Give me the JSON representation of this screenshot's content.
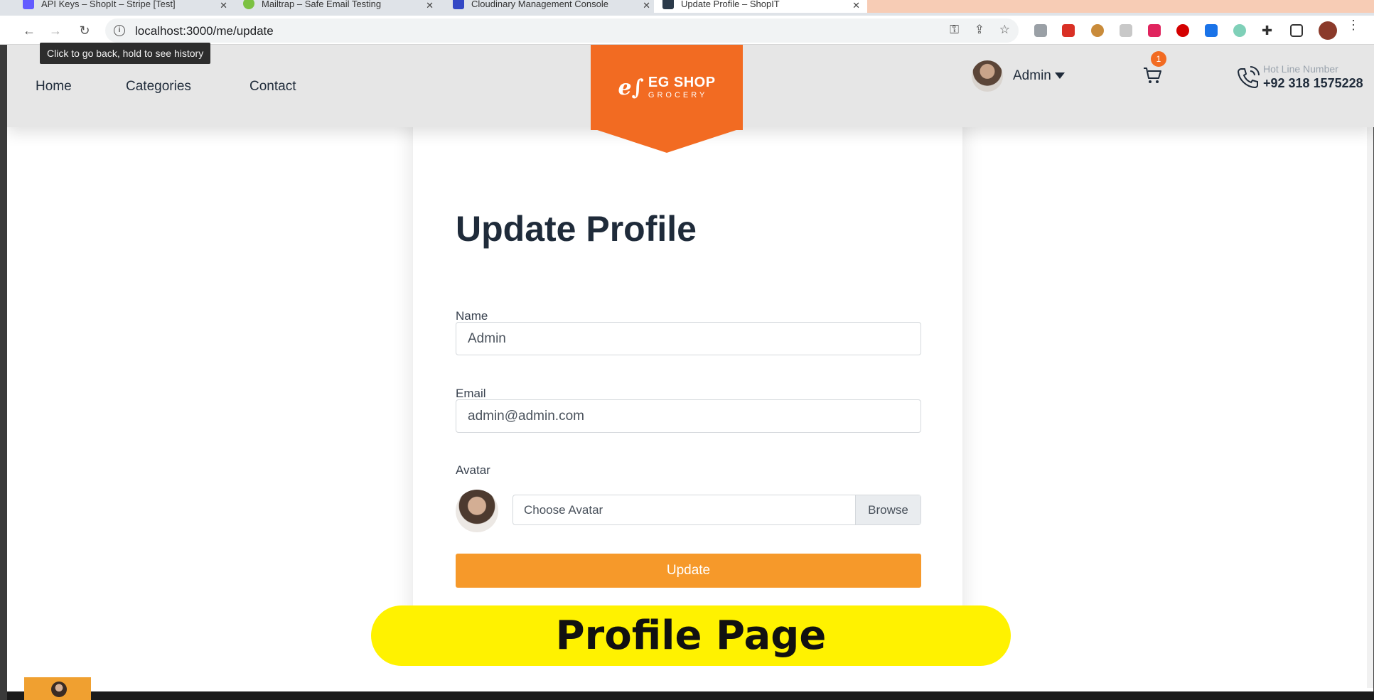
{
  "browser": {
    "tabs": [
      {
        "title": "API Keys – ShopIt – Stripe [Test]",
        "color": "#635bff"
      },
      {
        "title": "Mailtrap – Safe Email Testing",
        "color": "#7cc142"
      },
      {
        "title": "Cloudinary Management Console",
        "color": "#3448c5"
      },
      {
        "title": "Update Profile – ShopIT",
        "color": "#2b3a4a"
      }
    ],
    "url": "localhost:3000/me/update",
    "back_tooltip": "Click to go back, hold to see history"
  },
  "header": {
    "nav": [
      "Home",
      "Categories",
      "Contact"
    ],
    "logo_line1": "EG SHOP",
    "logo_line2": "GROCERY",
    "logo_mark": "e∫",
    "user_name": "Admin",
    "cart_count": "1",
    "hotline_label": "Hot Line Number",
    "hotline_number": "+92 318 1575228"
  },
  "form": {
    "title": "Update Profile",
    "name_label": "Name",
    "name_value": "Admin",
    "email_label": "Email",
    "email_value": "admin@admin.com",
    "avatar_label": "Avatar",
    "file_placeholder": "Choose Avatar",
    "browse_label": "Browse",
    "submit_label": "Update"
  },
  "caption": "Profile Page",
  "colors": {
    "brand_orange": "#f26b22",
    "button_orange": "#f6992a",
    "caption_yellow": "#fff200"
  }
}
